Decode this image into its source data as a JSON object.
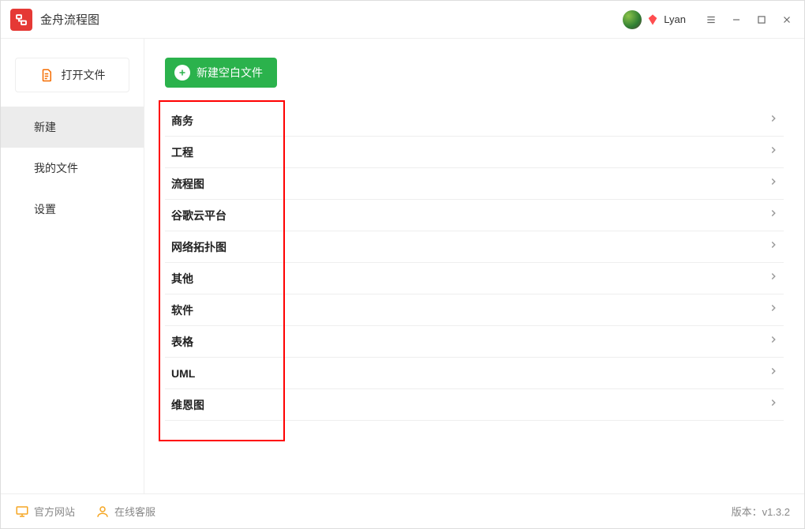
{
  "app": {
    "title": "金舟流程图"
  },
  "user": {
    "name": "Lyan"
  },
  "sidebar": {
    "open_label": "打开文件",
    "items": [
      {
        "label": "新建",
        "active": true
      },
      {
        "label": "我的文件",
        "active": false
      },
      {
        "label": "设置",
        "active": false
      }
    ]
  },
  "main": {
    "create_label": "新建空白文件",
    "categories": [
      {
        "label": "商务"
      },
      {
        "label": "工程"
      },
      {
        "label": "流程图"
      },
      {
        "label": "谷歌云平台"
      },
      {
        "label": "网络拓扑图"
      },
      {
        "label": "其他"
      },
      {
        "label": "软件"
      },
      {
        "label": "表格"
      },
      {
        "label": "UML"
      },
      {
        "label": "维恩图"
      }
    ]
  },
  "footer": {
    "official_site": "官方网站",
    "online_support": "在线客服",
    "version_prefix": "版本：",
    "version": "v1.3.2"
  }
}
